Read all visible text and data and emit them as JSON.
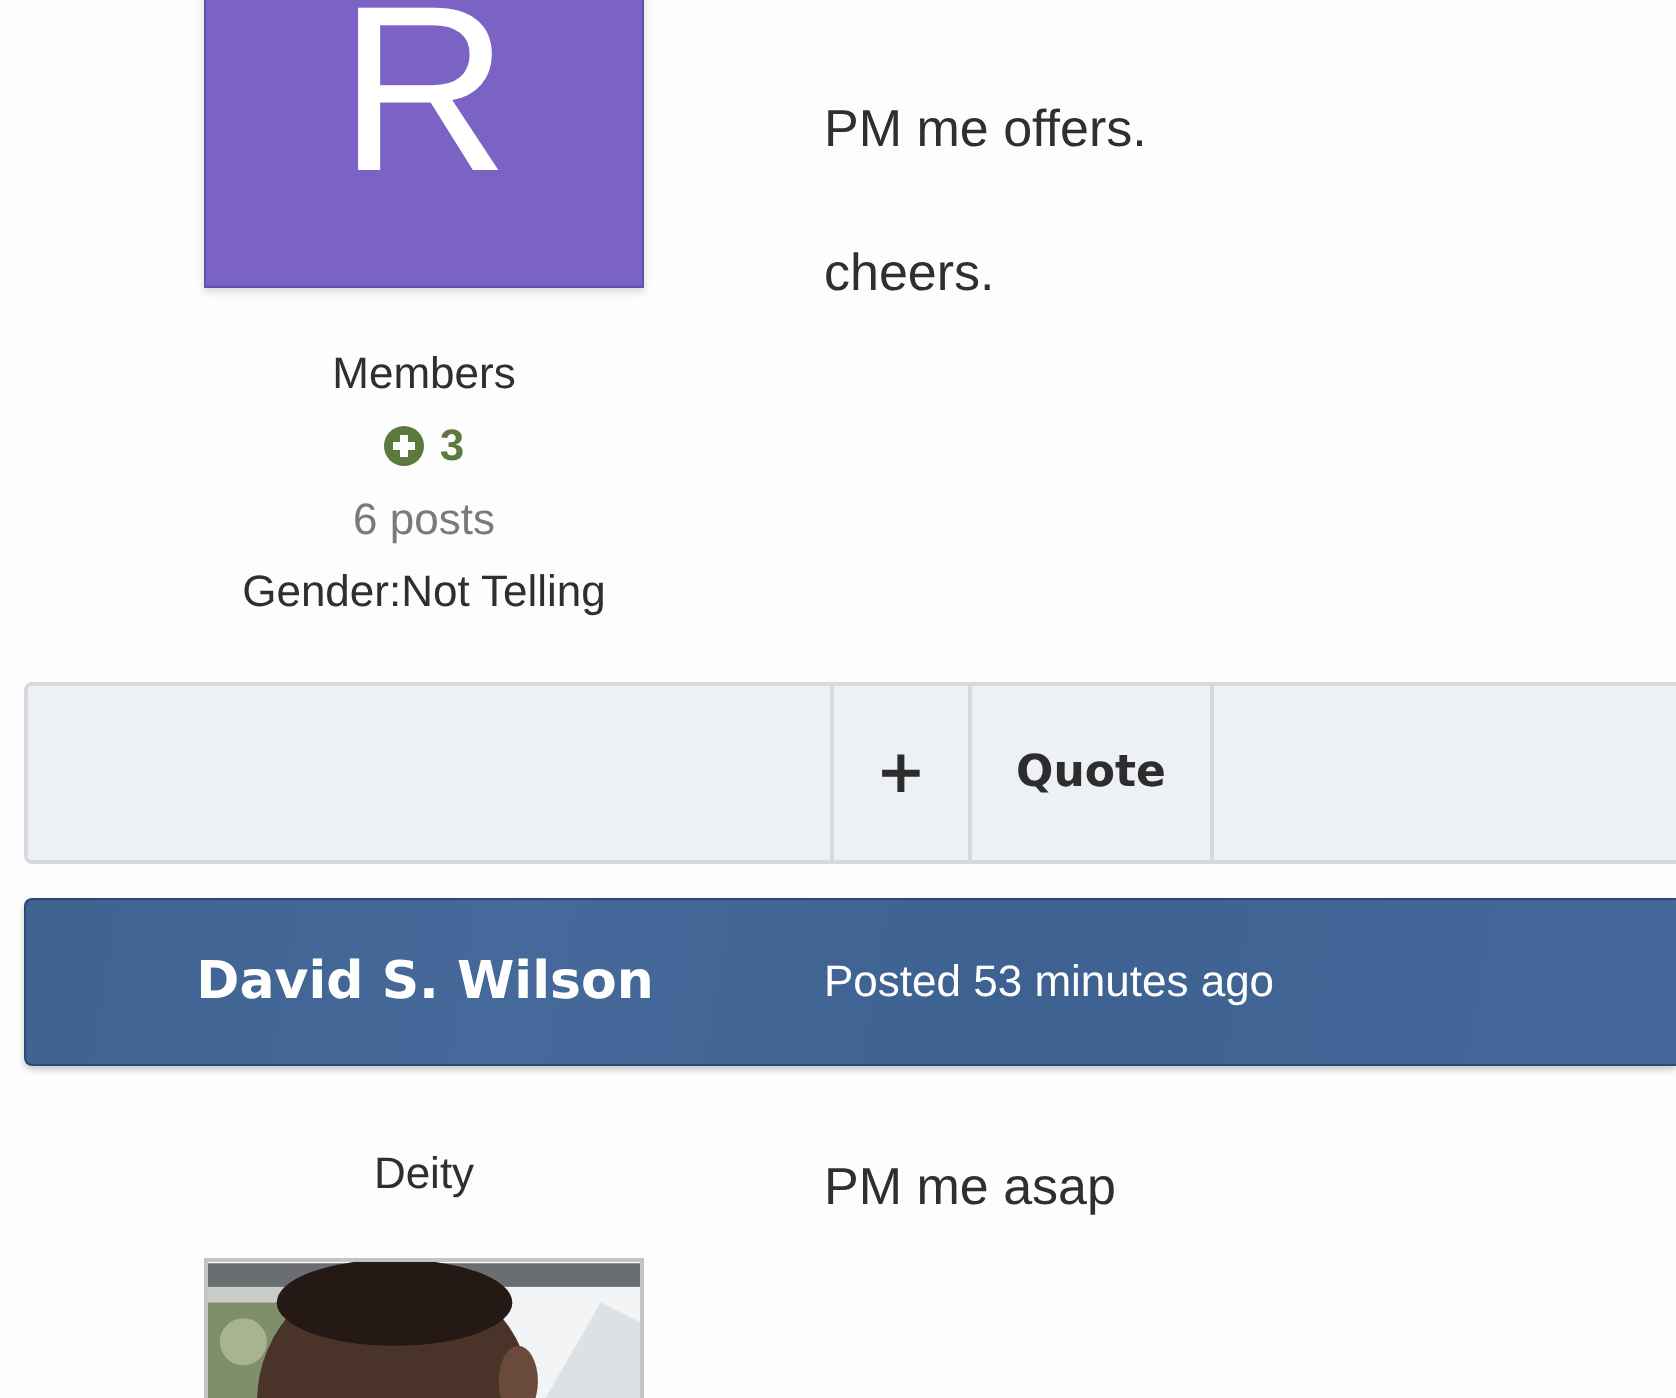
{
  "posts": [
    {
      "avatar": {
        "kind": "letter",
        "letter": "R"
      },
      "author_group": "Members",
      "reputation": "3",
      "post_count": "6 posts",
      "gender": "Gender:Not Telling",
      "content": [
        "PM me offers.",
        "cheers."
      ],
      "actions": [
        {
          "kind": "plus",
          "label": "+"
        },
        {
          "kind": "quote",
          "label": "Quote"
        }
      ]
    },
    {
      "author": "David S. Wilson",
      "posted": "Posted 53 minutes ago",
      "author_group": "Deity",
      "avatar": {
        "kind": "picture"
      },
      "content": [
        "PM me asap"
      ]
    }
  ]
}
